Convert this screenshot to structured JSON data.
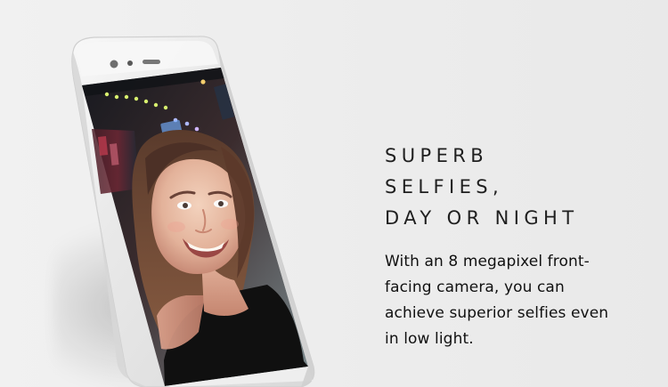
{
  "headline": {
    "line1": "SUPERB",
    "line2": "SELFIES,",
    "line3": "DAY OR NIGHT"
  },
  "description": "With an 8 megapixel front-facing camera, you can achieve superior selfies even in low light.",
  "colors": {
    "background": "#ededed",
    "text": "#1f1f1f",
    "phone_frame": "#e7e7e7",
    "screen_dark": "#1b1f26"
  }
}
